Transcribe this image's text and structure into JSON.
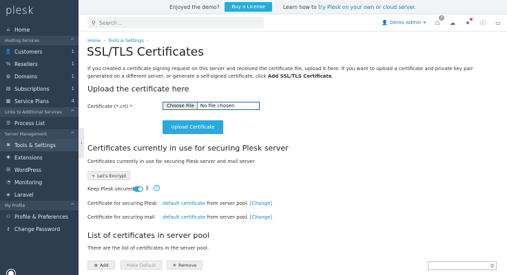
{
  "sidebar": {
    "logo": "plesk",
    "home": "Home",
    "sections": [
      {
        "label": "Hosting Services",
        "items": [
          {
            "label": "Customers",
            "count": "1",
            "icon": "users-icon"
          },
          {
            "label": "Resellers",
            "count": "1",
            "icon": "percent-icon"
          },
          {
            "label": "Domains",
            "count": "1",
            "icon": "globe-icon"
          },
          {
            "label": "Subscriptions",
            "count": "1",
            "icon": "subscriptions-icon"
          },
          {
            "label": "Service Plans",
            "count": "4",
            "icon": "service-plans-icon"
          }
        ]
      },
      {
        "label": "Links to Additional Services",
        "items": [
          {
            "label": "Process List",
            "icon": "list-icon"
          }
        ]
      },
      {
        "label": "Server Management",
        "items": [
          {
            "label": "Tools & Settings",
            "icon": "wrench-icon"
          },
          {
            "label": "Extensions",
            "icon": "puzzle-icon"
          },
          {
            "label": "WordPress",
            "icon": "wordpress-icon"
          },
          {
            "label": "Monitoring",
            "icon": "monitoring-icon"
          },
          {
            "label": "Laravel",
            "icon": "laravel-icon"
          }
        ]
      },
      {
        "label": "My Profile",
        "items": [
          {
            "label": "Profile & Preferences",
            "icon": "profile-icon"
          },
          {
            "label": "Change Password",
            "icon": "key-icon"
          }
        ]
      }
    ]
  },
  "topbar": {
    "demo_text": "Enjoyed the demo?",
    "buy_label": "Buy a License",
    "learn_text": "Learn how to",
    "learn_link": "try Plesk on your own or cloud server."
  },
  "header": {
    "search_placeholder": "Search...",
    "user": "Demo Admin",
    "notifications_count": "2"
  },
  "breadcrumb": {
    "home": "Home",
    "tools": "Tools & Settings"
  },
  "page": {
    "title": "SSL/TLS Certificates",
    "intro_1": "If you created a certificate signing request on this server and received the certificate file, upload it here. If you want to upload a certificate and private key pair generated on a different server, or generate a self-signed certificate, click ",
    "intro_bold": "Add SSL/TLS Certificate",
    "intro_2": "."
  },
  "upload": {
    "heading": "Upload the certificate here",
    "field_label": "Certificate (*.crt)",
    "required_mark": "*",
    "choose_file": "Choose File",
    "no_file": "No file chosen",
    "button": "Upload Certificate"
  },
  "in_use": {
    "heading": "Certificates currently in use for securing Plesk server",
    "description": "Certificates currently in use for securing Plesk server and mail server",
    "lets_encrypt": "Let's Encrypt",
    "keep_secured": "Keep Plesk secured",
    "plesk_label": "Certificate for securing Plesk",
    "mail_label": "Certificate for securing mail",
    "default_cert": "default certificate",
    "from_pool": " from server pool. ",
    "change": "[Change]"
  },
  "pool": {
    "heading": "List of certificates in server pool",
    "description": "There are the list of certificates in the server pool.",
    "add": "Add",
    "make_default": "Make Default",
    "remove": "Remove"
  }
}
